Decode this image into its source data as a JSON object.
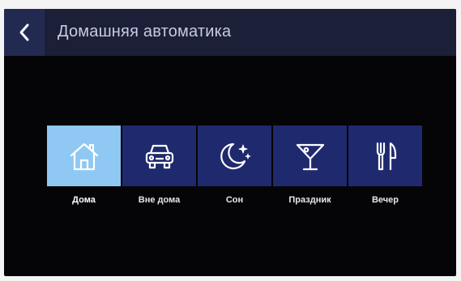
{
  "header": {
    "back_icon": "chevron-left-icon",
    "title": "Домашняя автоматика"
  },
  "modes": [
    {
      "label": "Дома",
      "icon": "house-icon",
      "active": true
    },
    {
      "label": "Вне дома",
      "icon": "car-icon",
      "active": false
    },
    {
      "label": "Сон",
      "icon": "moon-stars-icon",
      "active": false
    },
    {
      "label": "Праздник",
      "icon": "cocktail-icon",
      "active": false
    },
    {
      "label": "Вечер",
      "icon": "fork-knife-icon",
      "active": false
    }
  ],
  "colors": {
    "background": "#050508",
    "header": "#1b1f38",
    "back_button": "#232a52",
    "tile": "#1f2a6e",
    "tile_active": "#8fc8f2"
  }
}
